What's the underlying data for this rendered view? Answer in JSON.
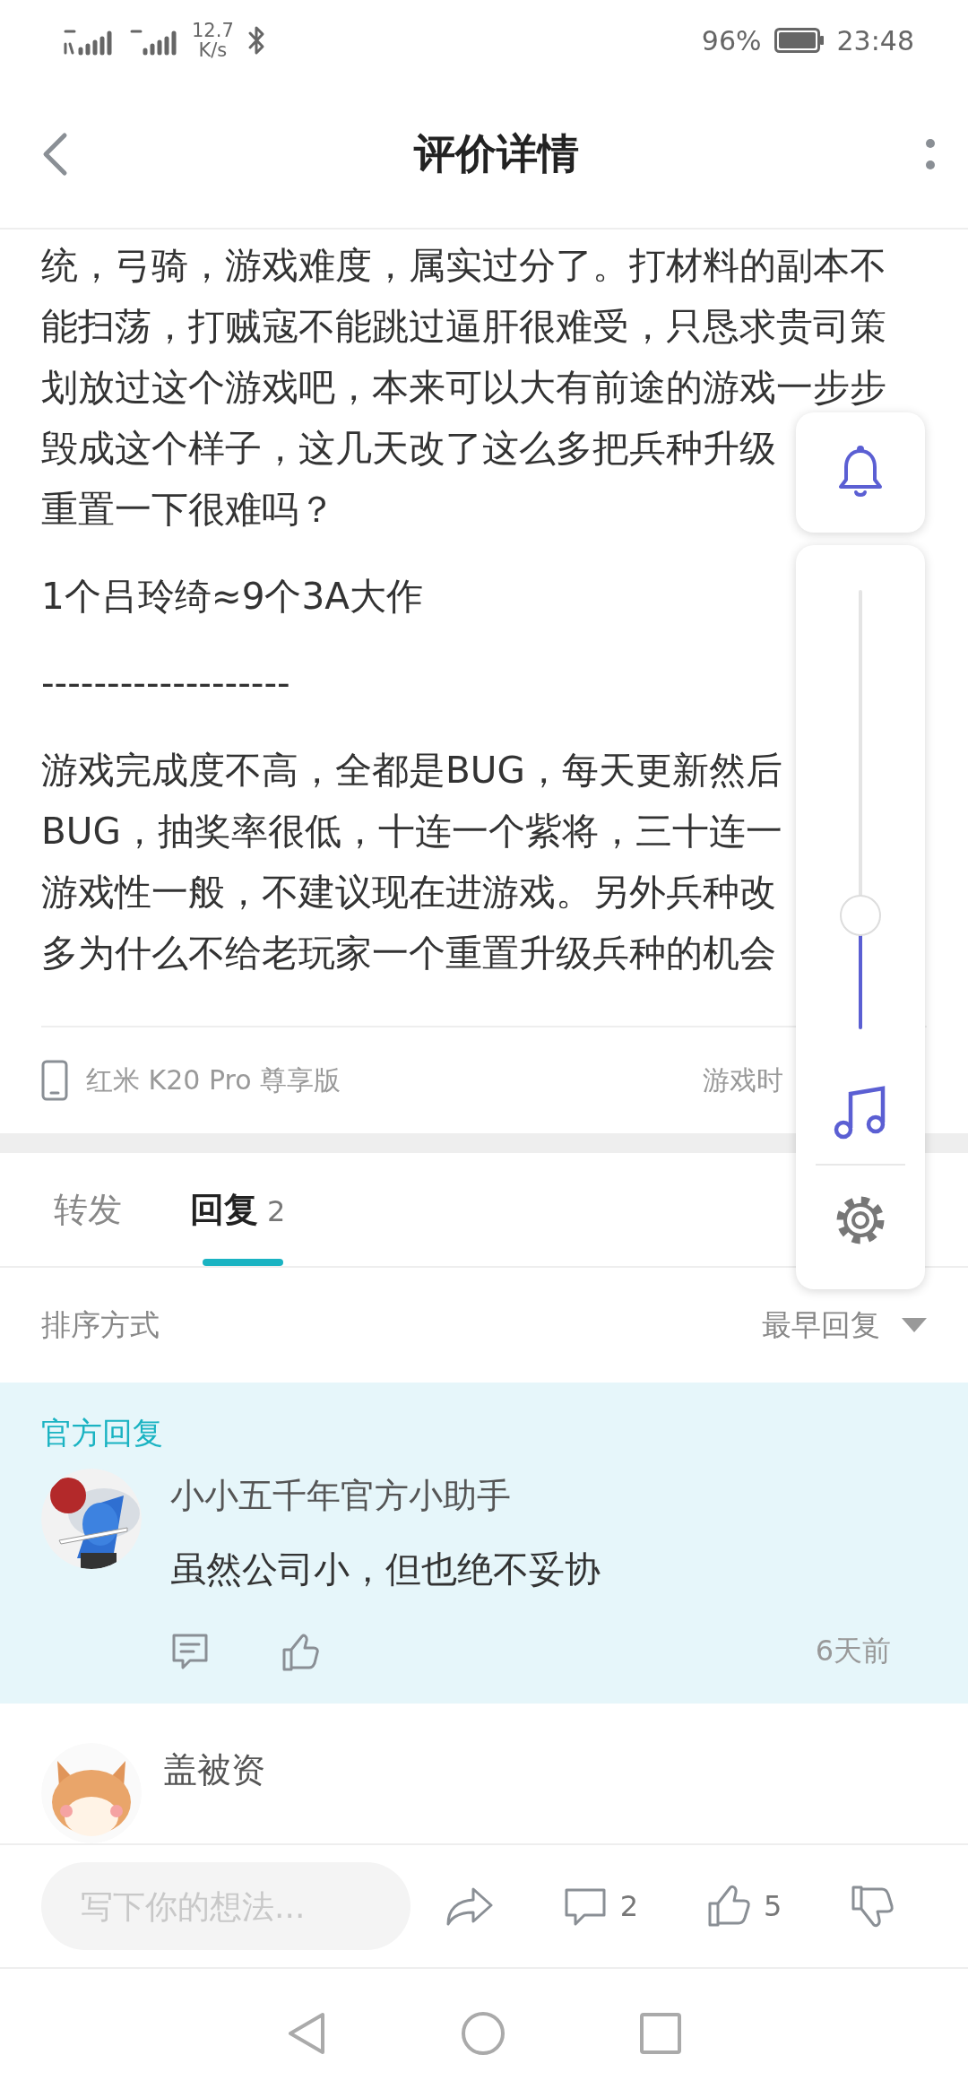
{
  "status_bar": {
    "net_speed_value": "12.7",
    "net_speed_unit": "K/s",
    "battery": "96%",
    "time": "23:48"
  },
  "header": {
    "title": "评价详情"
  },
  "review": {
    "paragraphs": [
      {
        "lines": [
          "统，弓骑，游戏难度，属实过分了。打材料的副本不",
          "能扫荡，打贼寇不能跳过逼肝很难受，只恳求贵司策",
          "划放过这个游戏吧，本来可以大有前途的游戏一步步",
          "毁成这个样子，这几天改了这么多把兵种升级",
          "重置一下很难吗？"
        ]
      },
      {
        "lines": [
          "1个吕玲绮≈9个3A大作"
        ]
      },
      {
        "lines": [
          "-------------------"
        ]
      },
      {
        "lines": [
          "游戏完成度不高，全都是BUG，每天更新然后",
          "BUG，抽奖率很低，十连一个紫将，三十连一",
          "游戏性一般，不建议现在进游戏。另外兵种改",
          "多为什么不给老玩家一个重置升级兵种的机会"
        ]
      }
    ]
  },
  "device": {
    "name": "红米 K20 Pro 尊享版",
    "playtime": "游戏时"
  },
  "tabs": [
    {
      "label": "转发",
      "selected": false
    },
    {
      "label": "回复",
      "count": "2",
      "selected": true
    }
  ],
  "sort": {
    "label": "排序方式",
    "value": "最早回复"
  },
  "replies": [
    {
      "kind": "official",
      "badge": "官方回复",
      "author": "小小五千年官方小助手",
      "text": "虽然公司小，但也绝不妥协",
      "time": "6天前"
    },
    {
      "kind": "normal",
      "author": "盖被资"
    }
  ],
  "floating_panel": {
    "volume": {
      "level": 0.26
    }
  },
  "bottom_bar": {
    "placeholder": "写下你的想法...",
    "comments": "2",
    "likes": "5"
  }
}
